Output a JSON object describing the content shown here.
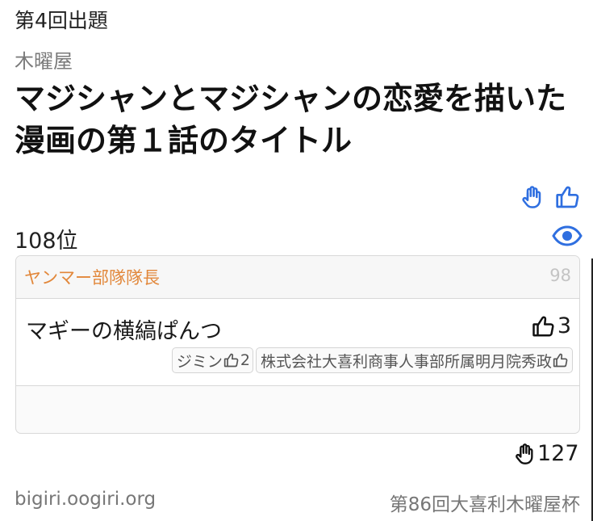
{
  "header": {
    "round_title": "第4回出題",
    "author": "木曜屋",
    "odai": "マジシャンとマジシャンの恋愛を描いた漫画の第１話のタイトル"
  },
  "stats": {
    "rank": "108位"
  },
  "card": {
    "judge_name": "ヤンマー部隊隊長",
    "judge_score": "98",
    "answer_text": "マギーの横縞ぱんつ",
    "answer_likes": "3",
    "voters": [
      {
        "name": "ジミン",
        "count": "2"
      },
      {
        "name": "株式会社大喜利商事人事部所属明月院秀政",
        "count": ""
      }
    ]
  },
  "footer": {
    "raise_count": "127",
    "site": "bigiri.oogiri.org",
    "event": "第86回大喜利木曜屋杯"
  },
  "colors": {
    "accent_blue": "#2f6fe0",
    "judge_orange": "#e2873a"
  },
  "icons": [
    "raised-hand-icon",
    "thumbs-up-icon",
    "eye-icon"
  ]
}
